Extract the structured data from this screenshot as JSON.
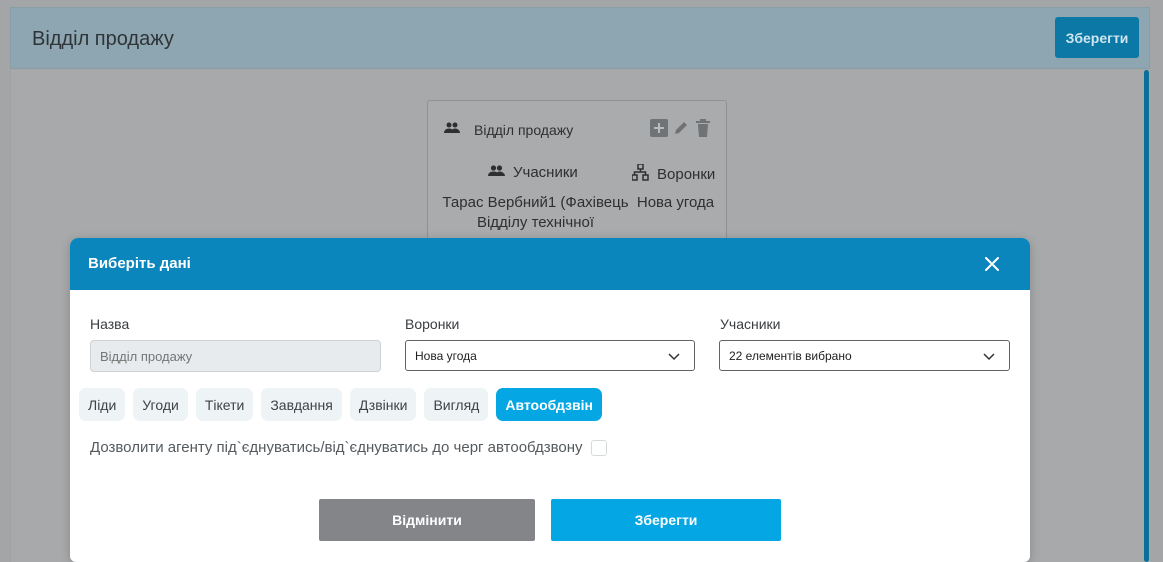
{
  "page": {
    "title": "Відділ продажу",
    "save_label": "Зберегти"
  },
  "card": {
    "title": "Відділ продажу",
    "members_heading": "Учасники",
    "funnels_heading": "Воронки",
    "members_value": "Тарас Вербний1 (Фахівець Відділу технічної",
    "funnels_value": "Нова угода"
  },
  "modal": {
    "title": "Виберіть дані",
    "name_label": "Назва",
    "name_placeholder": "Відділ продажу",
    "funnels_label": "Воронки",
    "funnels_value": "Нова угода",
    "members_label": "Учасники",
    "members_value": "22 елементів вибрано",
    "tabs": [
      {
        "label": "Ліди",
        "active": false
      },
      {
        "label": "Угоди",
        "active": false
      },
      {
        "label": "Тікети",
        "active": false
      },
      {
        "label": "Завдання",
        "active": false
      },
      {
        "label": "Дзвінки",
        "active": false
      },
      {
        "label": "Вигляд",
        "active": false
      },
      {
        "label": "Автообдзвін",
        "active": true
      }
    ],
    "permission_label": "Дозволити агенту під`єднуватись/від`єднуватись до черг автообдзвону",
    "cancel_label": "Відмінити",
    "save_label": "Зберегти"
  },
  "colors": {
    "accent": "#04a7e4",
    "header": "#0b86bd",
    "cancel": "#838588"
  }
}
